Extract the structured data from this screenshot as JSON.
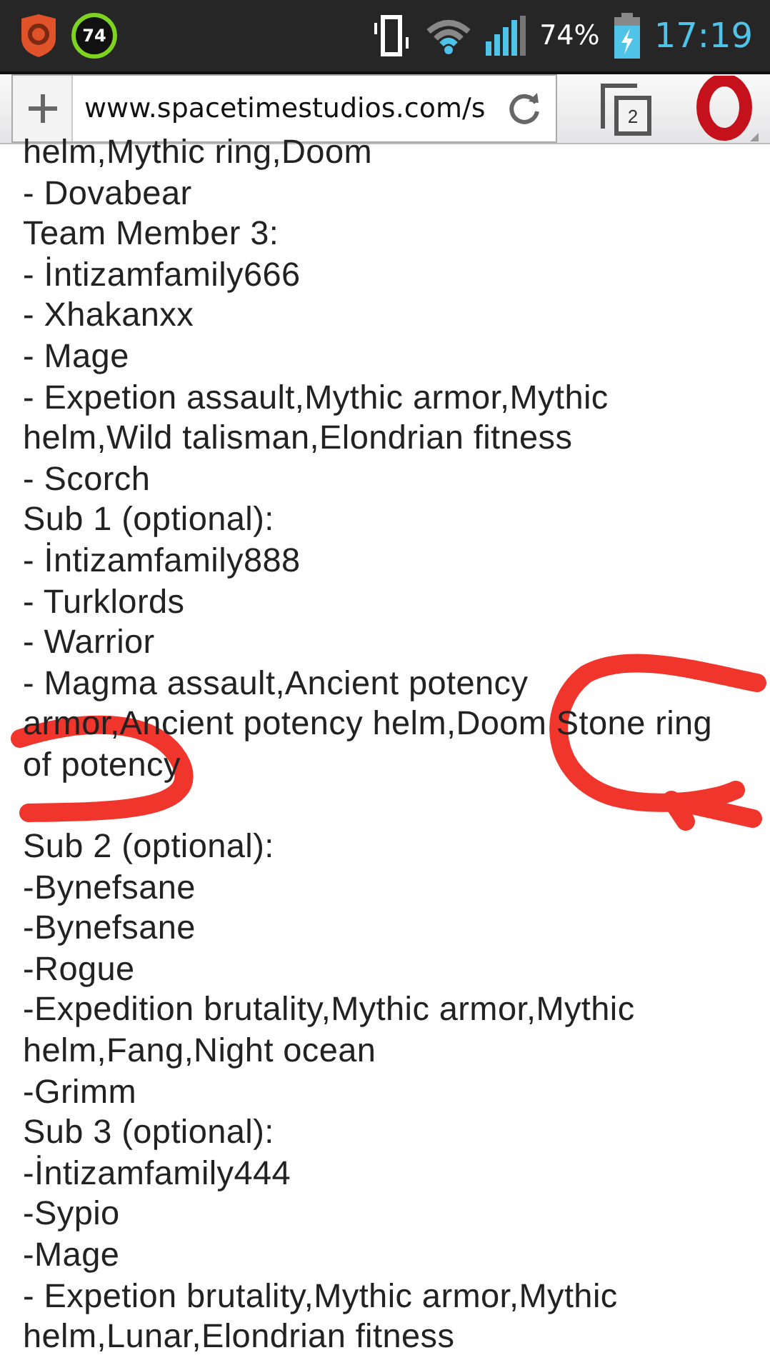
{
  "status_bar": {
    "notification_badge": "74",
    "battery_percent": "74%",
    "time": "17:19"
  },
  "browser_bar": {
    "url": "www.spacetimestudios.com/s",
    "tab_count": "2"
  },
  "content_lines": [
    "helm,Mythic ring,Doom",
    "- Dovabear",
    "Team Member 3:",
    "- İntizamfamily666",
    "- Xhakanxx",
    "- Mage",
    "- Expetion assault,Mythic armor,Mythic",
    "helm,Wild talisman,Elondrian fitness",
    "- Scorch",
    "Sub 1 (optional):",
    "- İntizamfamily888",
    "- Turklords",
    "- Warrior",
    "- Magma assault,Ancient potency",
    "armor,Ancient potency helm,Doom Stone ring",
    "of potency",
    {
      "text": "Sub 2 (optional):",
      "covered_line_before": true
    },
    "-Bynefsane",
    "-Bynefsane",
    "-Rogue",
    "-Expedition brutality,Mythic armor,Mythic",
    "helm,Fang,Night ocean",
    "-Grimm",
    "Sub 3 (optional):",
    "-İntizamfamily444",
    "-Sypio",
    "-Mage",
    "- Expetion brutality,Mythic armor,Mythic",
    "helm,Lunar,Elondrian fitness"
  ]
}
